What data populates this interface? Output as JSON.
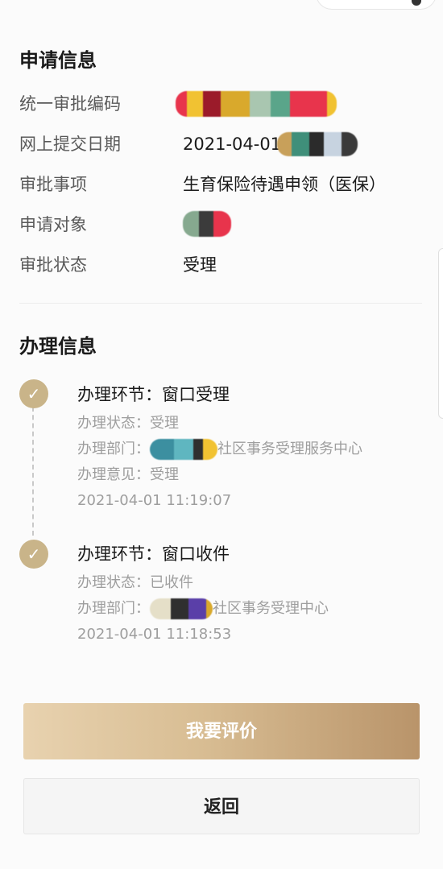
{
  "apply_info": {
    "title": "申请信息",
    "rows": [
      {
        "label": "统一审批编码",
        "value": ""
      },
      {
        "label": "网上提交日期",
        "value": "2021-04-01"
      },
      {
        "label": "审批事项",
        "value": "生育保险待遇申领（医保）"
      },
      {
        "label": "申请对象",
        "value": ""
      },
      {
        "label": "审批状态",
        "value": "受理"
      }
    ]
  },
  "process_info": {
    "title": "办理信息",
    "steps": [
      {
        "title": "办理环节：窗口受理",
        "status": "办理状态：受理",
        "dept_prefix": "办理部门：",
        "dept_suffix": "社区事务受理服务中心",
        "opinion": "办理意见：受理",
        "time": "2021-04-01 11:19:07"
      },
      {
        "title": "办理环节：窗口收件",
        "status": "办理状态：已收件",
        "dept_prefix": "办理部门：",
        "dept_suffix": "社区事务受理中心",
        "time": "2021-04-01 11:18:53"
      }
    ]
  },
  "buttons": {
    "rate": "我要评价",
    "back": "返回"
  },
  "colors": {
    "accent": "#c9b489",
    "button_gradient_start": "#e8d2af",
    "button_gradient_end": "#b9946a"
  }
}
